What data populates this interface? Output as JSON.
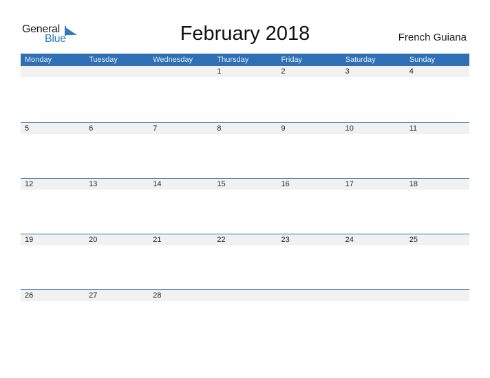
{
  "logo": {
    "general": "General",
    "blue": "Blue"
  },
  "title": "February 2018",
  "country": "French Guiana",
  "days": [
    "Monday",
    "Tuesday",
    "Wednesday",
    "Thursday",
    "Friday",
    "Saturday",
    "Sunday"
  ],
  "weeks": [
    [
      "",
      "",
      "",
      "1",
      "2",
      "3",
      "4"
    ],
    [
      "5",
      "6",
      "7",
      "8",
      "9",
      "10",
      "11"
    ],
    [
      "12",
      "13",
      "14",
      "15",
      "16",
      "17",
      "18"
    ],
    [
      "19",
      "20",
      "21",
      "22",
      "23",
      "24",
      "25"
    ],
    [
      "26",
      "27",
      "28",
      "",
      "",
      "",
      ""
    ]
  ],
  "colors": {
    "accent": "#2e70b3",
    "logo_blue": "#2b7bc6",
    "row_strip": "#f1f1f1"
  }
}
